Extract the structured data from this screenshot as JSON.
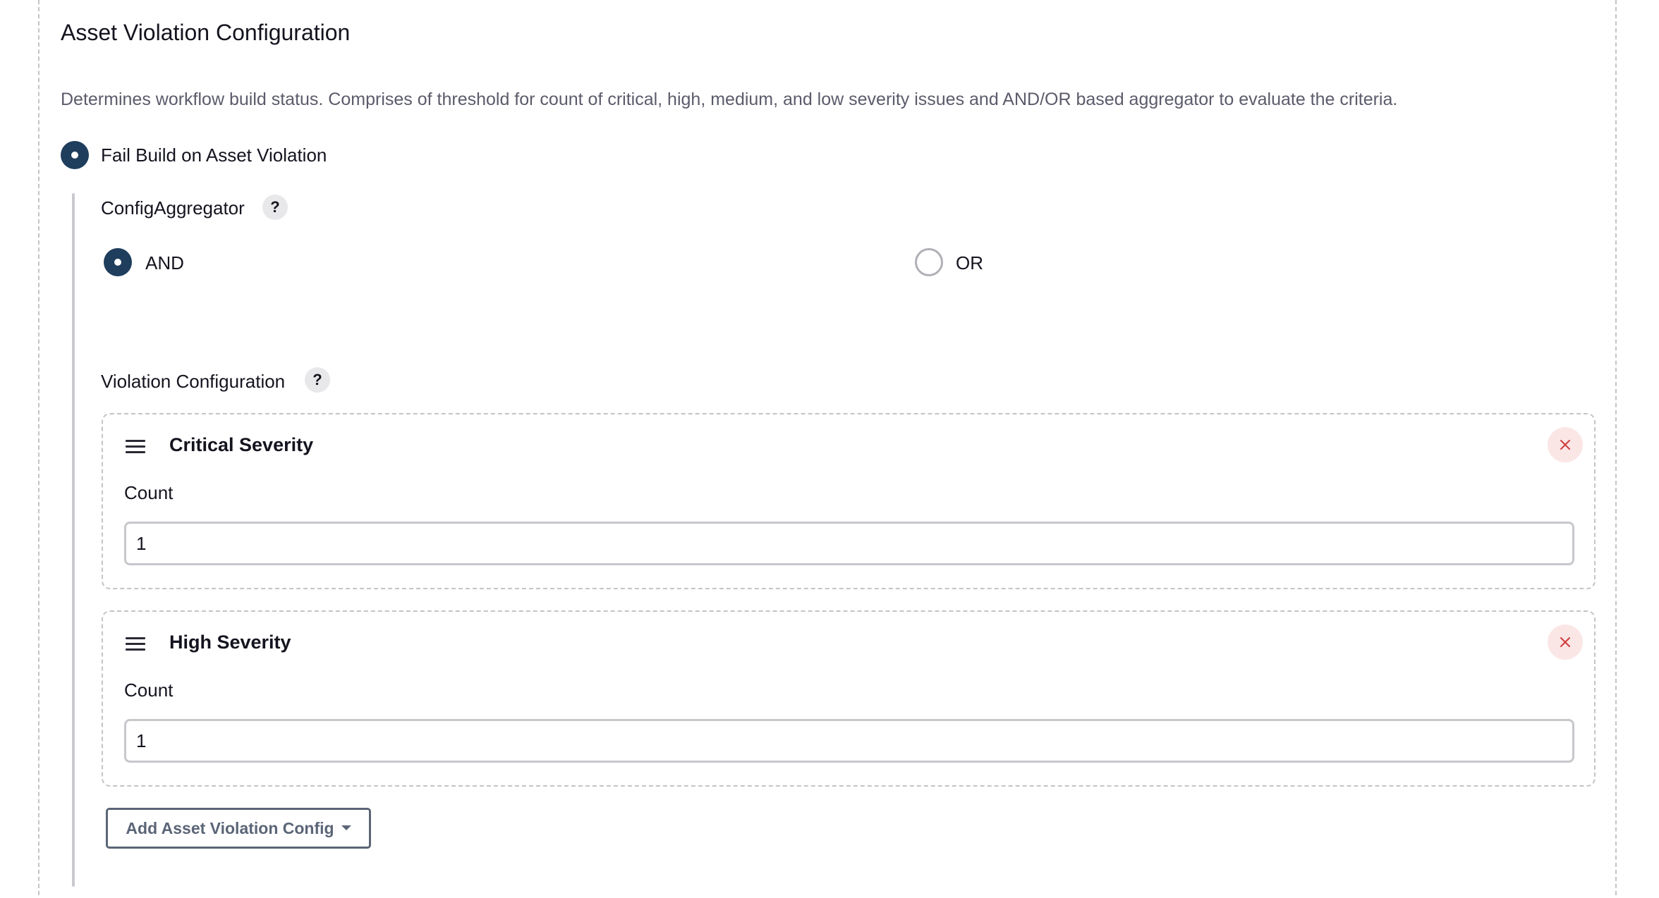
{
  "section": {
    "title": "Asset Violation Configuration",
    "description": "Determines workflow build status. Comprises of threshold for count of critical, high, medium, and low severity issues and AND/OR based aggregator to evaluate the criteria."
  },
  "fail_build_option": {
    "label": "Fail Build on Asset Violation",
    "selected": true
  },
  "config_aggregator": {
    "label": "ConfigAggregator",
    "help": "?",
    "options": [
      {
        "label": "AND",
        "selected": true
      },
      {
        "label": "OR",
        "selected": false
      }
    ]
  },
  "violation_configuration": {
    "label": "Violation Configuration",
    "help": "?",
    "cards": [
      {
        "title": "Critical Severity",
        "count_label": "Count",
        "count_value": "1"
      },
      {
        "title": "High Severity",
        "count_label": "Count",
        "count_value": "1"
      }
    ]
  },
  "add_button": {
    "label": "Add Asset Violation Config"
  },
  "colors": {
    "radio_selected": "#1f3d5c",
    "close_bg": "#fbe6e6",
    "close_icon": "#d03b3b",
    "button_text": "#5b6577"
  }
}
